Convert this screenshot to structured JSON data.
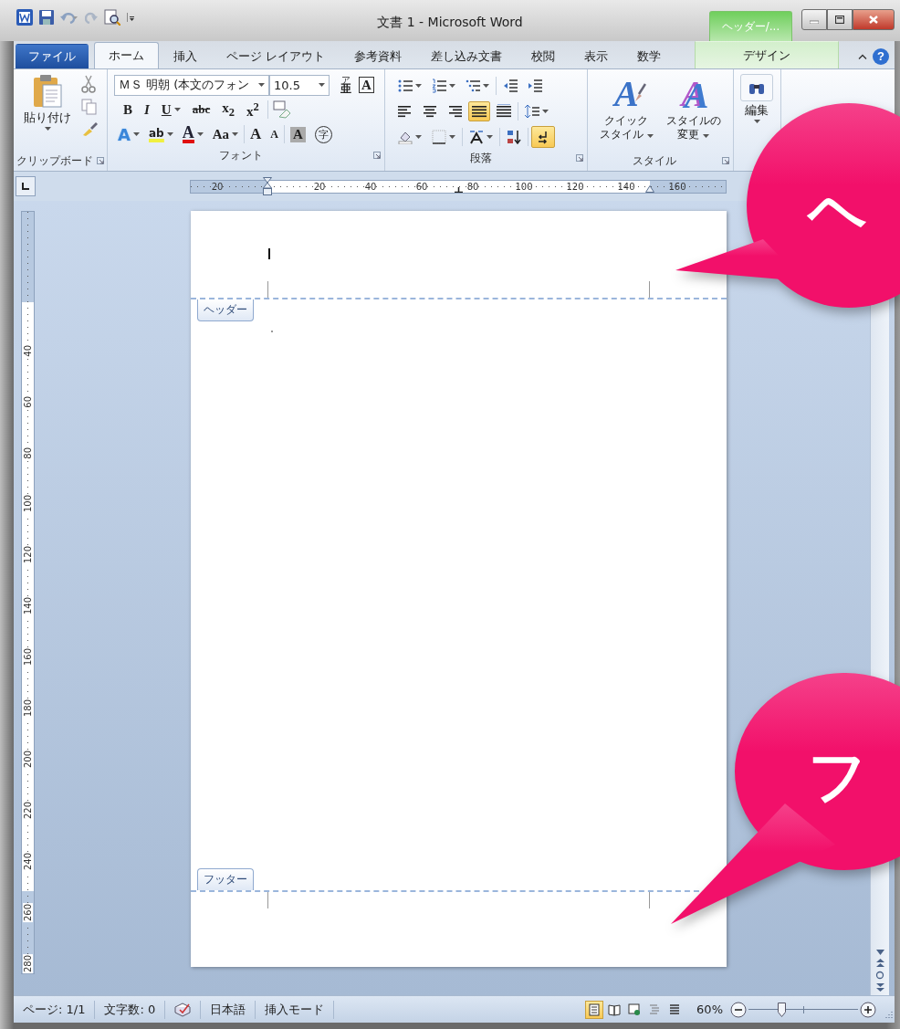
{
  "window": {
    "title": "文書 1 - Microsoft Word",
    "context_header": "ヘッダー/..."
  },
  "tabs": [
    {
      "label": "ファイル",
      "kind": "file",
      "selected": false
    },
    {
      "label": "ホーム",
      "kind": "tab",
      "selected": true
    },
    {
      "label": "挿入",
      "kind": "tab",
      "selected": false
    },
    {
      "label": "ページ レイアウト",
      "kind": "tab",
      "selected": false
    },
    {
      "label": "参考資料",
      "kind": "tab",
      "selected": false
    },
    {
      "label": "差し込み文書",
      "kind": "tab",
      "selected": false
    },
    {
      "label": "校閲",
      "kind": "tab",
      "selected": false
    },
    {
      "label": "表示",
      "kind": "tab",
      "selected": false
    },
    {
      "label": "数学",
      "kind": "tab",
      "selected": false
    },
    {
      "label": "デザイン",
      "kind": "context",
      "selected": false
    }
  ],
  "ribbon": {
    "clipboard": {
      "paste": "貼り付け",
      "label": "クリップボード"
    },
    "font": {
      "name": "ＭＳ 明朝 (本文のフォン",
      "size": "10.5",
      "label": "フォント",
      "top_tools": [
        {
          "kind": "ruby",
          "text": "亜",
          "ruby": "ア",
          "menu": false
        },
        {
          "kind": "boxed",
          "text": "A",
          "menu": false
        }
      ],
      "format_tools": [
        {
          "kind": "bold",
          "text": "B",
          "menu": false
        },
        {
          "kind": "italic",
          "text": "I",
          "menu": false
        },
        {
          "kind": "underline",
          "text": "U",
          "menu": true
        },
        {
          "kind": "strike",
          "text": "abc",
          "menu": false
        },
        {
          "kind": "subscript",
          "text": "x$_{2}$",
          "menu": false
        },
        {
          "kind": "superscript",
          "text": "x$^{2}$",
          "menu": false
        }
      ],
      "effect_tools": [
        {
          "kind": "effect",
          "text": "A",
          "menu": true
        },
        {
          "kind": "highlight",
          "text": "ab",
          "menu": true
        },
        {
          "kind": "color",
          "text": "A",
          "menu": true
        },
        {
          "kind": "case",
          "text": "Aa",
          "menu": true
        },
        {
          "kind": "grow",
          "text": "A",
          "menu": false
        },
        {
          "kind": "shrink",
          "text": "A",
          "menu": false
        },
        {
          "kind": "shade",
          "text": "A",
          "menu": false
        },
        {
          "kind": "enclose",
          "text": "字",
          "menu": false
        }
      ]
    },
    "paragraph": {
      "label": "段落",
      "align": [
        {
          "selected": false
        },
        {
          "selected": false
        },
        {
          "selected": false
        },
        {
          "selected": true
        },
        {
          "selected": false
        }
      ],
      "show_marks": {
        "on": true
      }
    },
    "styles": {
      "label": "スタイル",
      "buttons": [
        {
          "kind": "quick",
          "glyph": "A",
          "lines": [
            "クイック",
            "スタイル"
          ]
        },
        {
          "kind": "change",
          "glyph": "A",
          "lines": [
            "スタイルの",
            "変更"
          ]
        }
      ]
    },
    "editing": {
      "label": "編集"
    }
  },
  "help": "?",
  "ruler": {
    "labels": [
      "20",
      "20",
      "40",
      "60",
      "80",
      "100",
      "120",
      "140",
      "160"
    ]
  },
  "vertical_ruler": {
    "labels": [
      "40",
      "60",
      "80",
      "100",
      "120",
      "140",
      "160",
      "180",
      "200",
      "220",
      "240",
      "260",
      "280"
    ]
  },
  "document": {
    "header_tab": "ヘッダー",
    "footer_tab": "フッター"
  },
  "status_bar": {
    "items": [
      "ページ: 1/1",
      "文字数: 0",
      "日本語",
      "挿入モード"
    ],
    "views": [
      {
        "selected": true
      },
      {
        "selected": false
      },
      {
        "selected": false
      },
      {
        "selected": false
      },
      {
        "selected": false
      }
    ],
    "zoom": "60%",
    "zoom_slider": {
      "level": 0.3
    }
  },
  "callouts": [
    {
      "text": "ヘ"
    },
    {
      "text": "フ"
    }
  ]
}
